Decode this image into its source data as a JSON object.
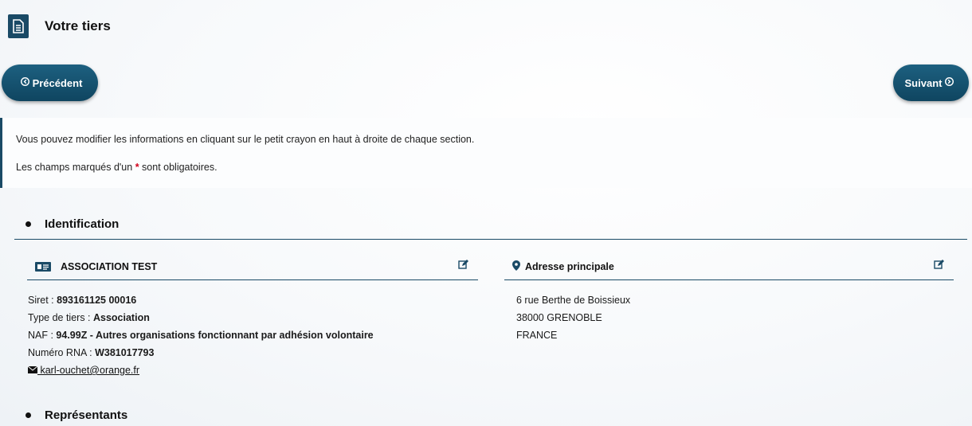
{
  "header": {
    "title": "Votre tiers"
  },
  "nav": {
    "prev_label": "Précédent",
    "next_label": "Suivant"
  },
  "info": {
    "line1": "Vous pouvez modifier les informations en cliquant sur le petit crayon en haut à droite de chaque section.",
    "line2_before": "Les champs marqués d'un ",
    "line2_star": "*",
    "line2_after": " sont obligatoires."
  },
  "sections": {
    "identification": "Identification",
    "representants": "Représentants"
  },
  "identity": {
    "name": "ASSOCIATION TEST",
    "siret_label": "Siret : ",
    "siret": "893161125 00016",
    "type_label": "Type de tiers : ",
    "type": "Association",
    "naf_label": "NAF : ",
    "naf": "94.99Z - Autres organisations fonctionnant par adhésion volontaire",
    "rna_label": "Numéro RNA : ",
    "rna": "W381017793",
    "email": " karl-ouchet@orange.fr"
  },
  "address": {
    "title": "Adresse principale",
    "line1": "6 rue Berthe de Boissieux",
    "line2": "38000 GRENOBLE",
    "line3": "FRANCE"
  },
  "icons": [
    "document-icon",
    "arrow-circle-left-icon",
    "arrow-circle-right-icon",
    "id-card-icon",
    "map-marker-icon",
    "edit-icon",
    "envelope-icon"
  ],
  "colors": {
    "primary": "#1a4a66",
    "required": "#d0021b"
  }
}
